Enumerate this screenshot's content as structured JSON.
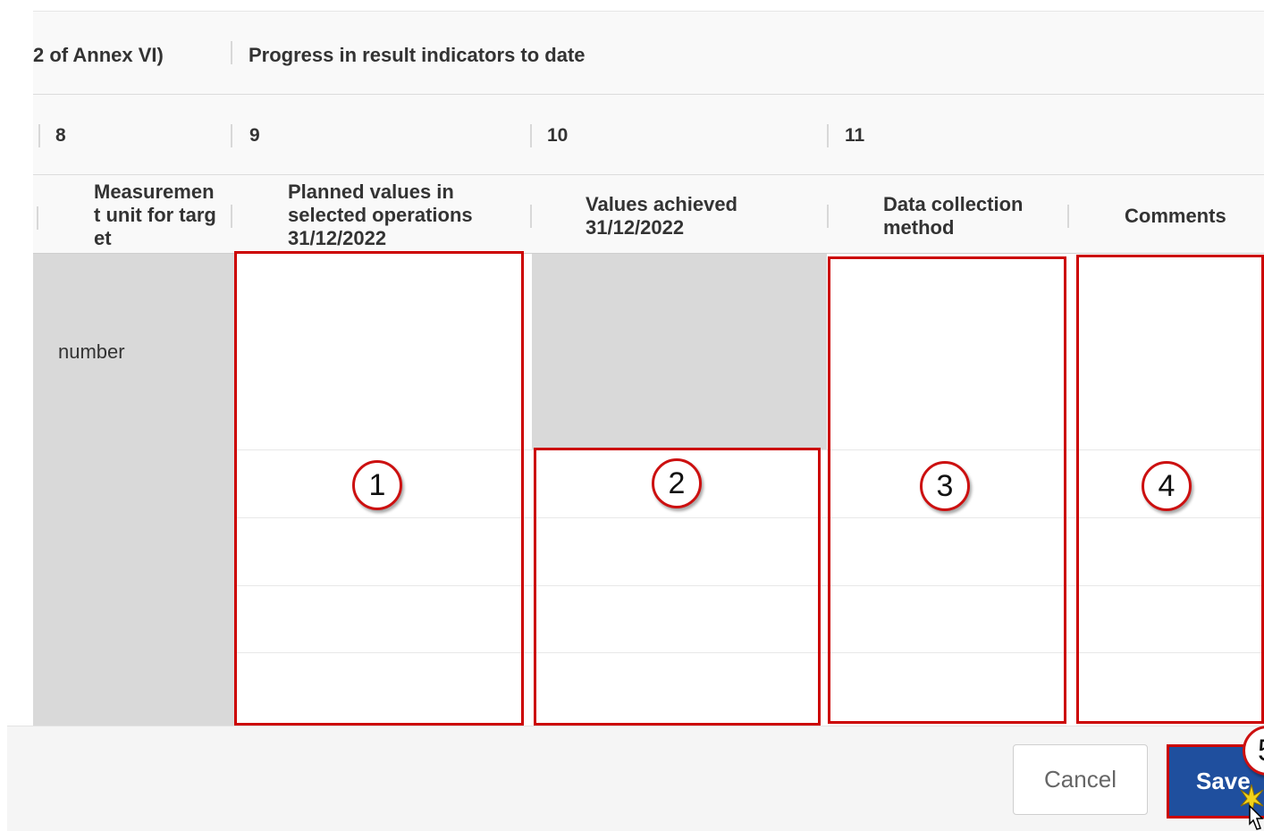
{
  "header": {
    "row1_left": "2 of Annex VI)",
    "row1_right": "Progress in result indicators to date",
    "col_numbers": [
      "8",
      "9",
      "10",
      "11"
    ]
  },
  "columns": {
    "measurement_unit": "Measurement unit for target",
    "planned_values": "Planned values in selected operations 31/12/2022",
    "values_achieved": "Values achieved 31/12/2022",
    "data_collection": "Data collection method",
    "comments": "Comments"
  },
  "rows": [
    {
      "measurement_unit": "number"
    }
  ],
  "annotations": [
    "1",
    "2",
    "3",
    "4",
    "5"
  ],
  "footer": {
    "cancel_label": "Cancel",
    "save_label": "Save"
  },
  "colors": {
    "highlight": "#cc0000",
    "save_button": "#1f4f9e",
    "disabled_cell": "#d9d9d9"
  }
}
